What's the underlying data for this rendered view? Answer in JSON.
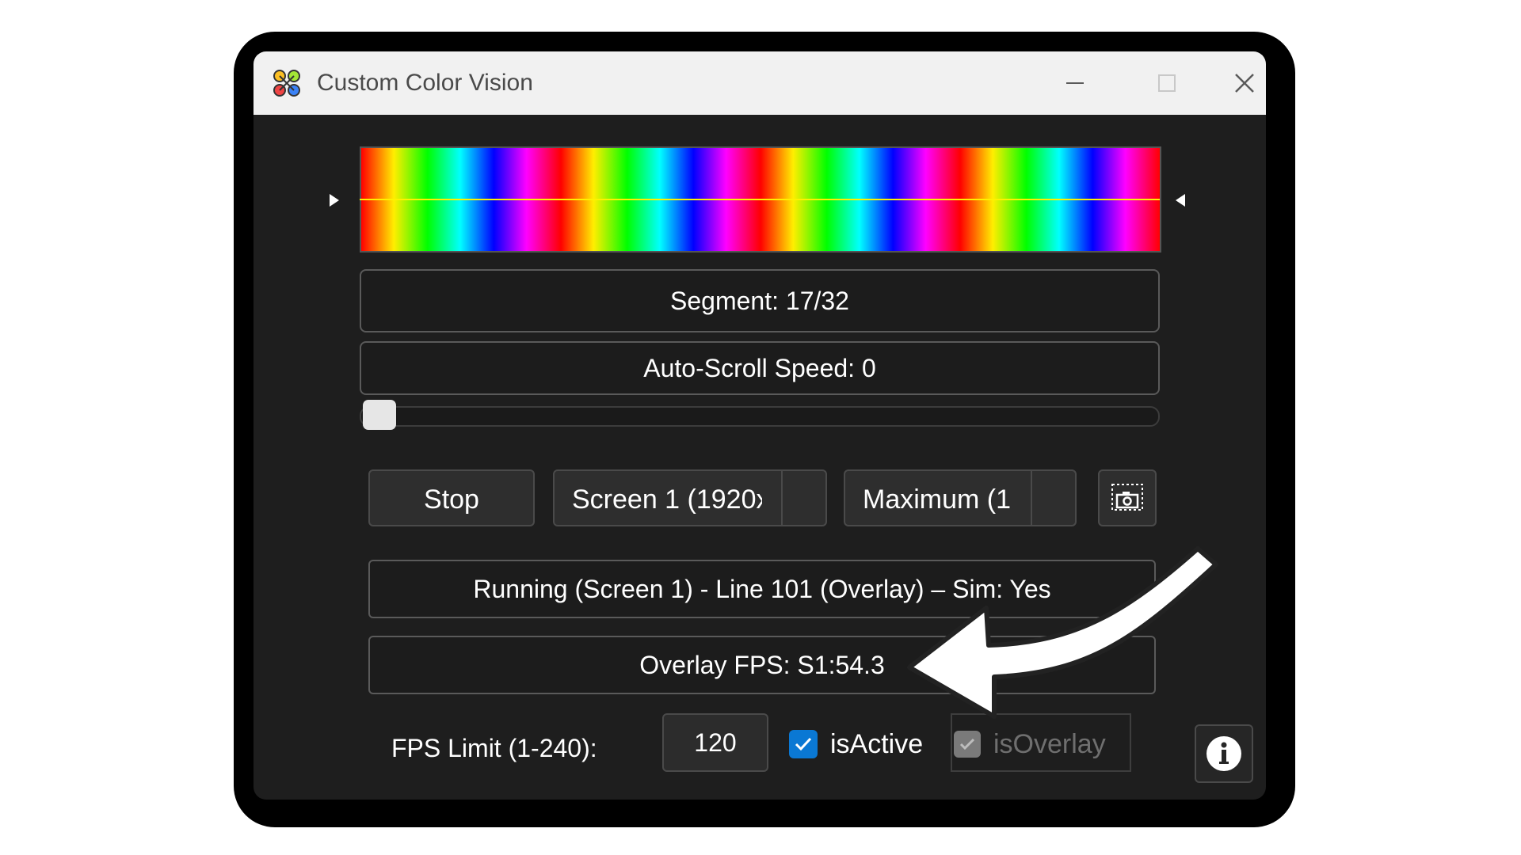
{
  "window": {
    "title": "Custom Color Vision"
  },
  "spectrum": {
    "segment_label": "Segment: 17/32",
    "auto_scroll_label": "Auto-Scroll Speed: 0",
    "auto_scroll_speed": 0
  },
  "controls": {
    "stop_label": "Stop",
    "screen_select_value": "Screen 1 (1920x",
    "mode_select_value": "Maximum (1",
    "snapshot_icon": "camera-icon"
  },
  "status": {
    "running_text": "Running (Screen 1) - Line 101 (Overlay) – Sim: Yes",
    "overlay_fps_text": "Overlay FPS: S1:54.3"
  },
  "footer": {
    "fps_limit_label": "FPS Limit (1-240):",
    "fps_limit_value": "120",
    "is_active_label": "isActive",
    "is_active_checked": true,
    "is_overlay_label": "isOverlay",
    "is_overlay_checked": true,
    "is_overlay_disabled": true,
    "info_icon": "info-icon"
  },
  "colors": {
    "window_bg": "#1e1e1e",
    "titlebar_bg": "#f1f1f1",
    "accent": "#0a78d4",
    "scanline": "#fff200"
  }
}
